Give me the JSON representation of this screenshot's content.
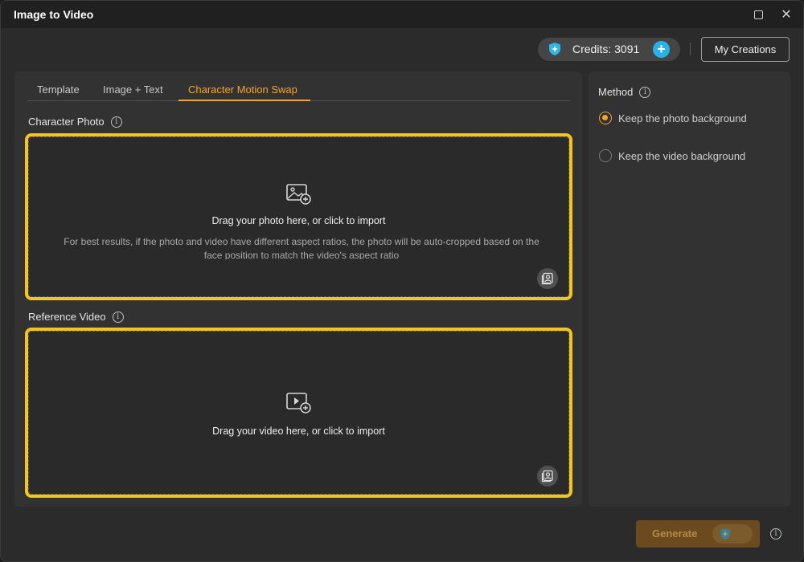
{
  "window": {
    "title": "Image to Video"
  },
  "header": {
    "credits_label": "Credits: 3091",
    "my_creations_label": "My Creations"
  },
  "tabs": [
    {
      "label": "Template",
      "active": false
    },
    {
      "label": "Image + Text",
      "active": false
    },
    {
      "label": "Character Motion Swap",
      "active": true
    }
  ],
  "character_photo": {
    "label": "Character Photo",
    "drop_title": "Drag your photo here, or click to import",
    "hint": "For best results, if the photo and video have different aspect ratios, the photo will be auto-cropped based on the face position to match the video's aspect ratio"
  },
  "reference_video": {
    "label": "Reference Video",
    "drop_title": "Drag your video here, or click to import"
  },
  "method": {
    "label": "Method",
    "options": [
      {
        "label": "Keep the photo background",
        "selected": true
      },
      {
        "label": "Keep the video background",
        "selected": false
      }
    ]
  },
  "footer": {
    "generate_label": "Generate"
  },
  "colors": {
    "accent": "#f3a531",
    "highlight_border": "#f5c518",
    "credits_add": "#27b3e8"
  }
}
